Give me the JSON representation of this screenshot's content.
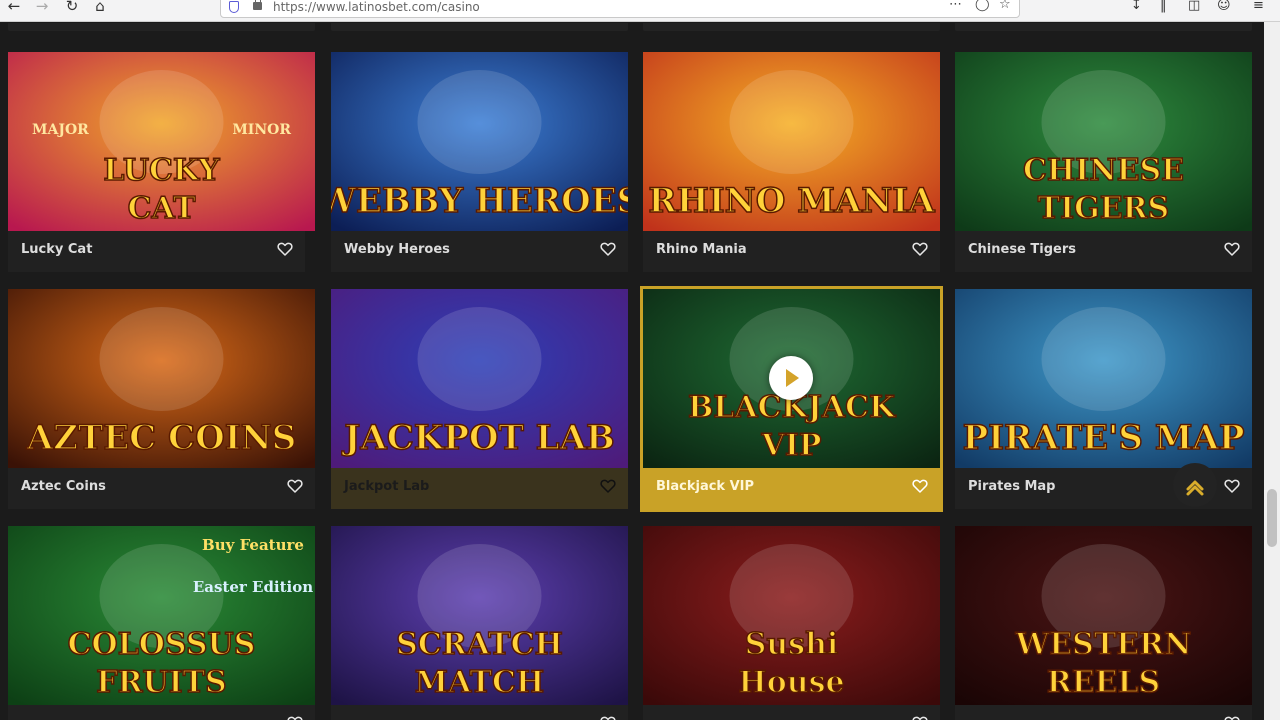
{
  "browser": {
    "url": "https://www.latinosbet.com/casino"
  },
  "games": [
    {
      "title": "Lucky Cat",
      "art_text": [
        "LUCKY",
        "CAT"
      ],
      "art_small": [
        "MAJOR",
        "MINOR"
      ],
      "bg": [
        "#f1a62a",
        "#b8184f"
      ]
    },
    {
      "title": "Webby Heroes",
      "art_text": [
        "WEBBY HEROES"
      ],
      "bg": [
        "#3d7fd6",
        "#0c1e55"
      ]
    },
    {
      "title": "Rhino Mania",
      "art_text": [
        "RHINO MANIA"
      ],
      "bg": [
        "#f6b026",
        "#c0321b"
      ]
    },
    {
      "title": "Chinese Tigers",
      "art_text": [
        "CHINESE",
        "TIGERS"
      ],
      "bg": [
        "#2e8b3e",
        "#0e3a18"
      ]
    },
    {
      "title": "Aztec Coins",
      "art_text": [
        "AZTEC COINS"
      ],
      "bg": [
        "#d96a18",
        "#3a1206"
      ]
    },
    {
      "title": "Jackpot Lab",
      "art_text": [
        "JACKPOT LAB"
      ],
      "bg": [
        "#2d3fb7",
        "#4e1b7a"
      ]
    },
    {
      "title": "Blackjack VIP",
      "art_text": [
        "BLACKJACK",
        "VIP"
      ],
      "bg": [
        "#1f6b33",
        "#0b2512"
      ]
    },
    {
      "title": "Pirates Map",
      "art_text": [
        "PIRATE'S MAP"
      ],
      "bg": [
        "#3f98c9",
        "#123b66"
      ]
    },
    {
      "title": "",
      "art_text": [
        "COLOSSUS",
        "FRUITS"
      ],
      "art_small": [
        "Buy Feature",
        "Easter Edition"
      ],
      "bg": [
        "#2a8a36",
        "#0d4015"
      ]
    },
    {
      "title": "",
      "art_text": [
        "SCRATCH",
        "MATCH"
      ],
      "bg": [
        "#5d3fb0",
        "#1e1346"
      ]
    },
    {
      "title": "",
      "art_text": [
        "Sushi",
        "House"
      ],
      "bg": [
        "#8b1d1d",
        "#3b0909"
      ]
    },
    {
      "title": "",
      "art_text": [
        "WESTERN",
        "REELS"
      ],
      "bg": [
        "#4a1414",
        "#1a0505"
      ]
    }
  ],
  "colors": {
    "accent": "#c9a227",
    "page_bg": "#1b1b1b",
    "card_bg": "#212121"
  }
}
